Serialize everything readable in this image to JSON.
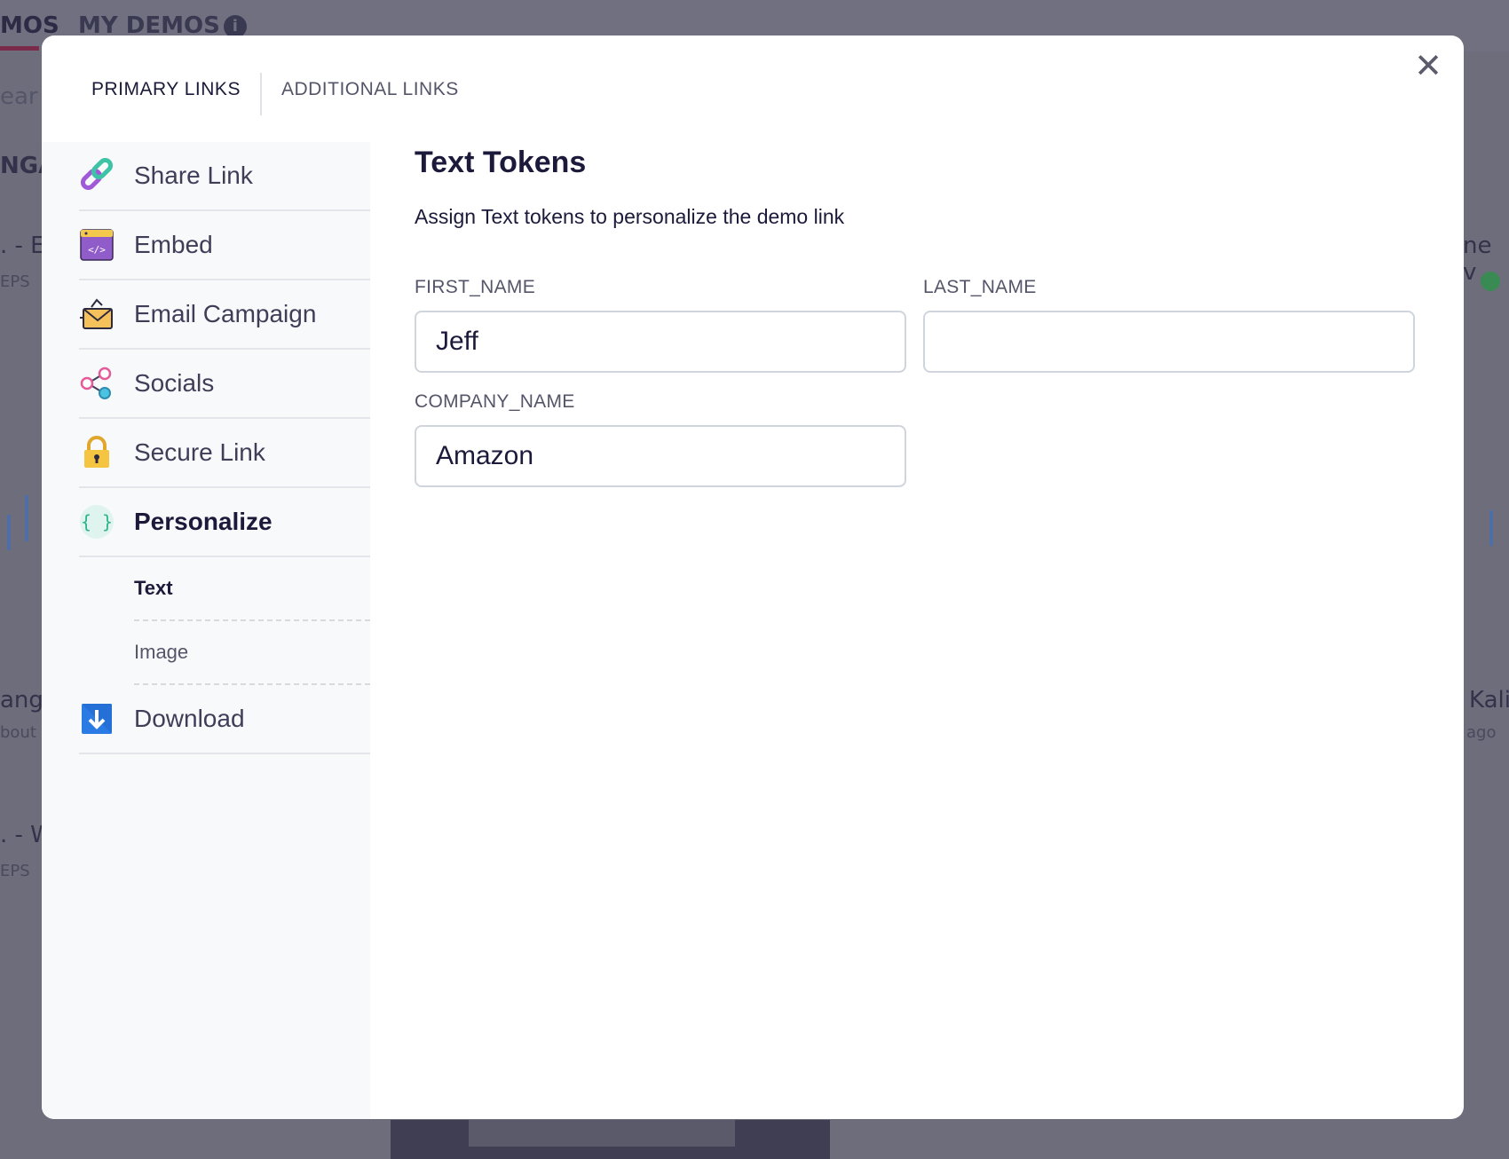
{
  "background": {
    "tabs": [
      "MOS",
      "MY DEMOS"
    ],
    "fragments": [
      "ear",
      "NGA",
      ". - E",
      "EPS",
      "ne v",
      "ang",
      "bout",
      "Kali",
      "ago",
      ". - W",
      "EPS"
    ]
  },
  "modal": {
    "close_glyph": "✕",
    "tabs": [
      {
        "label": "PRIMARY LINKS",
        "active": true
      },
      {
        "label": "ADDITIONAL LINKS",
        "active": false
      }
    ],
    "sidebar": {
      "items": [
        {
          "label": "Share Link",
          "icon": "link-icon",
          "active": false
        },
        {
          "label": "Embed",
          "icon": "embed-code-icon",
          "active": false
        },
        {
          "label": "Email Campaign",
          "icon": "email-envelope-icon",
          "active": false
        },
        {
          "label": "Socials",
          "icon": "share-nodes-icon",
          "active": false
        },
        {
          "label": "Secure Link",
          "icon": "padlock-icon",
          "active": false
        },
        {
          "label": "Personalize",
          "icon": "curly-braces-icon",
          "active": true
        }
      ],
      "sub_items": [
        {
          "label": "Text",
          "active": true
        },
        {
          "label": "Image",
          "active": false
        }
      ],
      "download": {
        "label": "Download",
        "icon": "download-icon"
      }
    },
    "content": {
      "title": "Text Tokens",
      "description": "Assign Text tokens to personalize the demo link",
      "fields": [
        {
          "label": "FIRST_NAME",
          "value": "Jeff"
        },
        {
          "label": "LAST_NAME",
          "value": ""
        },
        {
          "label": "COMPANY_NAME",
          "value": "Amazon"
        }
      ]
    }
  },
  "colors": {
    "accent": "#2fb38e",
    "text_dark": "#1c1a3a",
    "overlay": "#6d6d7b"
  }
}
